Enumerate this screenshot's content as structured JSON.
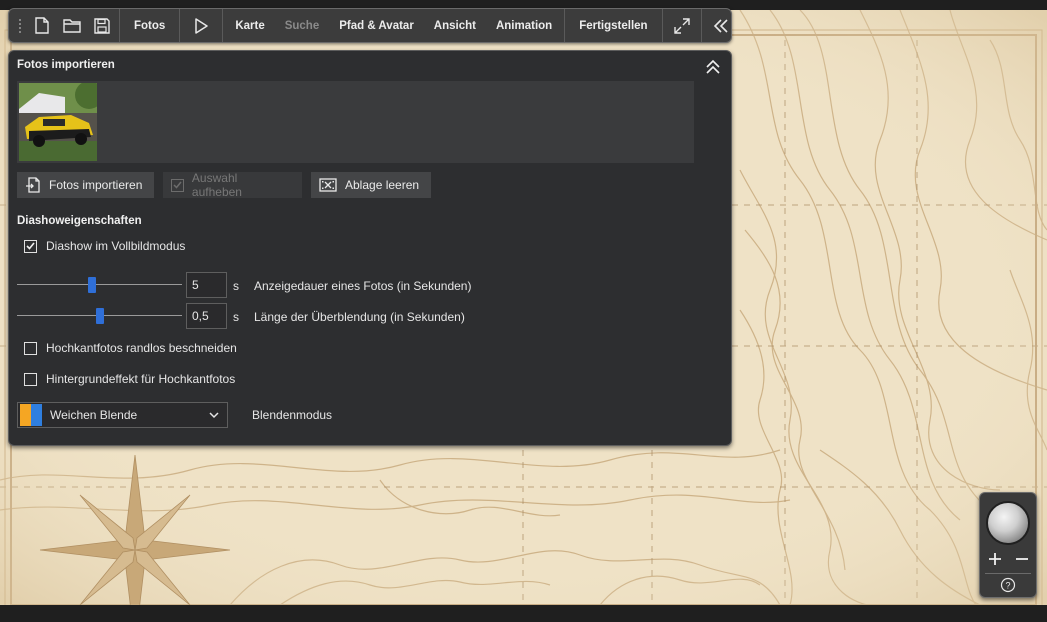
{
  "toolbar": {
    "items": [
      {
        "label": "Fotos"
      },
      {
        "label": "Karte"
      },
      {
        "label": "Suche",
        "disabled": true
      },
      {
        "label": "Pfad & Avatar"
      },
      {
        "label": "Ansicht"
      },
      {
        "label": "Animation"
      },
      {
        "label": "Fertigstellen"
      }
    ],
    "icons": [
      "grip-icon",
      "new-document-icon",
      "open-folder-icon",
      "save-icon",
      "play-icon",
      "fullscreen-icon",
      "collapse-left-icon"
    ]
  },
  "panel": {
    "title": "Fotos importieren",
    "buttons": {
      "import": "Fotos importieren",
      "deselect": "Auswahl aufheben",
      "clear": "Ablage leeren"
    },
    "section_title": "Diashoweigenschaften",
    "fullscreen_label": "Diashow im Vollbildmodus",
    "fullscreen_checked": true,
    "duration": {
      "value": "5",
      "unit": "s",
      "label": "Anzeigedauer eines Fotos (in Sekunden)",
      "slider_fraction": 0.45
    },
    "transition": {
      "value": "0,5",
      "unit": "s",
      "label": "Länge der Überblendung (in Sekunden)",
      "slider_fraction": 0.5
    },
    "crop_label": "Hochkantfotos randlos beschneiden",
    "crop_checked": false,
    "background_label": "Hintergrundeffekt für Hochkantfotos",
    "background_checked": false,
    "blend_mode": {
      "selected": "Weichen Blende",
      "label": "Blendenmodus",
      "swatch_colors": [
        "#f5a623",
        "#2f7fe0"
      ]
    }
  },
  "colors": {
    "panel_bg": "#2d2e30",
    "toolbar_bg": "#3c3c3c",
    "accent": "#2f6fd8",
    "map_bg": "#efe2c6"
  }
}
